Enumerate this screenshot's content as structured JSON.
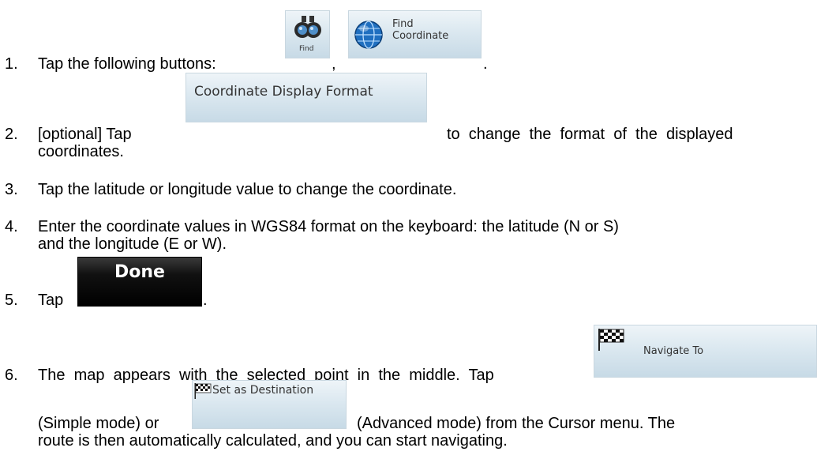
{
  "steps": [
    {
      "number": "1.",
      "text": "Tap the following buttons:",
      "sep1": ",",
      "sep2": "."
    },
    {
      "number": "2.",
      "pre": "[optional] Tap",
      "post": "to  change  the  format  of  the  displayed",
      "line2": "coordinates."
    },
    {
      "number": "3.",
      "text": "Tap the latitude or longitude value to change the coordinate."
    },
    {
      "number": "4.",
      "line1": "Enter the coordinate values in WGS84 format on the keyboard: the latitude (N or S)",
      "line2": "and the longitude (E or W)."
    },
    {
      "number": "5.",
      "pre": "Tap",
      "post": "."
    },
    {
      "number": "6.",
      "pre": "The  map  appears  with  the  selected  point  in  the  middle.  Tap",
      "mid": "(Simple mode) or",
      "post": "(Advanced mode) from the Cursor menu. The",
      "line3": "route is then automatically calculated, and you can start navigating."
    }
  ],
  "buttons": {
    "find": {
      "label": "Find",
      "icon": "binoculars-icon"
    },
    "find_coordinate": {
      "line1": "Find",
      "line2": "Coordinate",
      "icon": "globe-icon"
    },
    "coordinate_display_format": {
      "label": "Coordinate Display Format"
    },
    "done": {
      "label": "Done"
    },
    "navigate_to": {
      "label": "Navigate To",
      "icon": "checkered-flag-icon"
    },
    "set_as_destination": {
      "label": "Set as Destination",
      "icon": "checkered-flag-icon"
    }
  }
}
